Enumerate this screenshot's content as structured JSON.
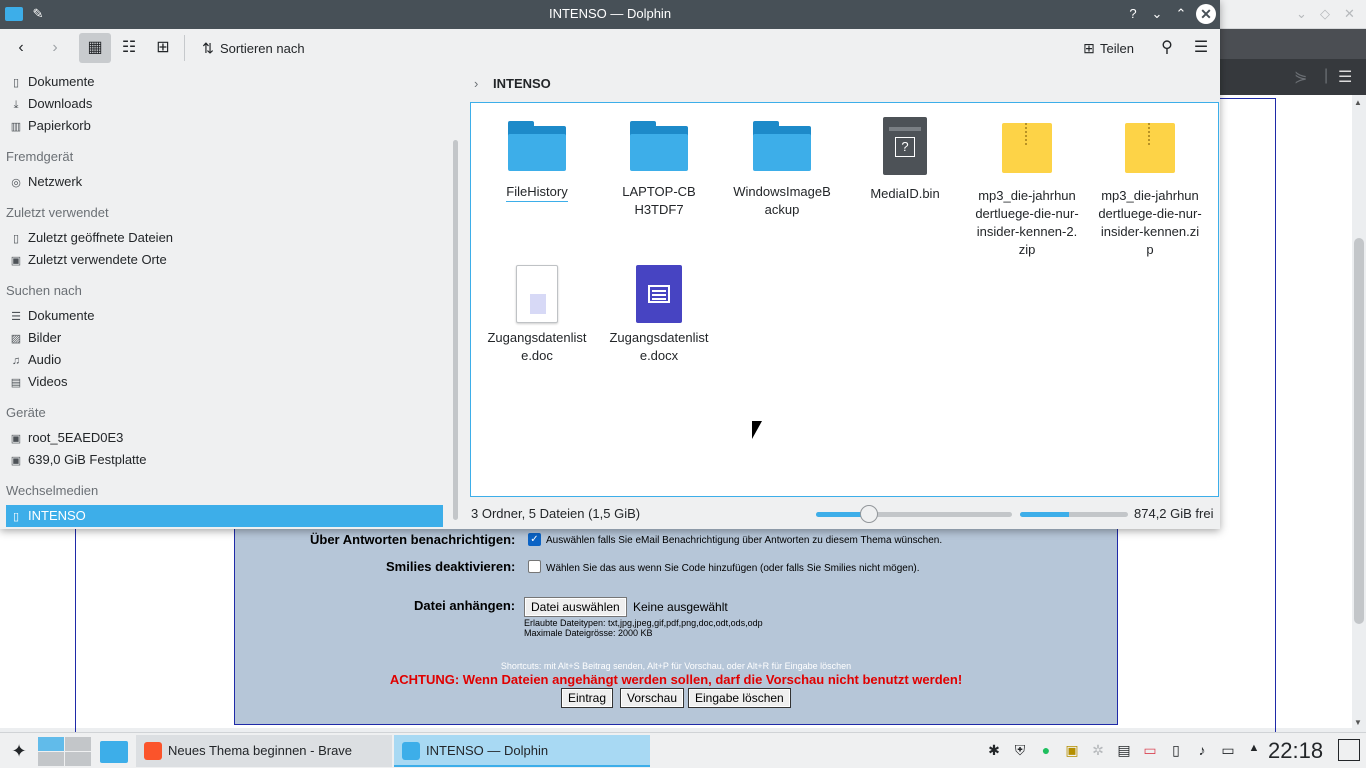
{
  "window": {
    "title": "INTENSO — Dolphin"
  },
  "toolbar": {
    "sort_label": "Sortieren nach",
    "share_label": "Teilen"
  },
  "sidebar": {
    "places": [
      {
        "label": "Dokumente",
        "icon": "document-icon"
      },
      {
        "label": "Downloads",
        "icon": "download-icon"
      },
      {
        "label": "Papierkorb",
        "icon": "trash-icon"
      }
    ],
    "remote_header": "Fremdgerät",
    "remote": [
      {
        "label": "Netzwerk",
        "icon": "network-icon"
      }
    ],
    "recent_header": "Zuletzt verwendet",
    "recent": [
      {
        "label": "Zuletzt geöffnete Dateien",
        "icon": "recent-files-icon"
      },
      {
        "label": "Zuletzt verwendete Orte",
        "icon": "recent-places-icon"
      }
    ],
    "search_header": "Suchen nach",
    "search": [
      {
        "label": "Dokumente",
        "icon": "document-search-icon"
      },
      {
        "label": "Bilder",
        "icon": "image-icon"
      },
      {
        "label": "Audio",
        "icon": "audio-icon"
      },
      {
        "label": "Videos",
        "icon": "video-icon"
      }
    ],
    "devices_header": "Geräte",
    "devices": [
      {
        "label": "root_5EAED0E3",
        "icon": "drive-icon"
      },
      {
        "label": "639,0 GiB Festplatte",
        "icon": "harddisk-icon"
      }
    ],
    "removable_header": "Wechselmedien",
    "removable": [
      {
        "label": "INTENSO",
        "icon": "usb-drive-icon",
        "selected": true
      }
    ]
  },
  "breadcrumb": {
    "current": "INTENSO"
  },
  "files": [
    {
      "name": "FileHistory",
      "type": "folder"
    },
    {
      "name": "LAPTOP-CBH3TDF7",
      "type": "folder"
    },
    {
      "name": "WindowsImageBackup",
      "type": "folder"
    },
    {
      "name": "MediaID.bin",
      "type": "binary"
    },
    {
      "name": "mp3_die-jahrhundertluege-die-nur-insider-kennen-2.zip",
      "type": "zip"
    },
    {
      "name": "mp3_die-jahrhundertluege-die-nur-insider-kennen.zip",
      "type": "zip"
    },
    {
      "name": "Zugangsdatenliste.doc",
      "type": "doc"
    },
    {
      "name": "Zugangsdatenliste.docx",
      "type": "docx"
    }
  ],
  "status": {
    "summary": "3 Ordner, 5 Dateien (1,5 GiB)",
    "free_space": "874,2 GiB frei",
    "zoom_fraction": 0.27,
    "used_fraction": 0.45
  },
  "browser_form": {
    "notify_label": "Über Antworten benachrichtigen:",
    "notify_text": "Auswählen falls Sie eMail Benachrichtigung über Antworten zu diesem Thema wünschen.",
    "smilies_label": "Smilies deaktivieren:",
    "smilies_text": "Wählen Sie das aus wenn Sie Code hinzufügen (oder falls Sie Smilies nicht mögen).",
    "attach_label": "Datei anhängen:",
    "choose_file": "Datei auswählen",
    "no_file": "Keine ausgewählt",
    "allowed_types": "Erlaubte Dateitypen: txt,jpg,jpeg,gif,pdf,png,doc,odt,ods,odp",
    "max_size": "Maximale Dateigrösse: 2000 KB",
    "shortcuts": "Shortcuts: mit Alt+S Beitrag senden, Alt+P für Vorschau, oder Alt+R für Eingabe löschen",
    "warning": "ACHTUNG: Wenn Dateien angehängt werden sollen, darf die Vorschau nicht benutzt werden!",
    "submit": "Eintrag",
    "preview": "Vorschau",
    "clear": "Eingabe löschen"
  },
  "taskbar": {
    "tasks": [
      {
        "label": "Neues Thema beginnen - Brave"
      },
      {
        "label": "INTENSO — Dolphin"
      }
    ],
    "clock": "22:18"
  },
  "colors": {
    "accent": "#3daee9",
    "titlebar": "#475057",
    "warning": "#e00000"
  }
}
